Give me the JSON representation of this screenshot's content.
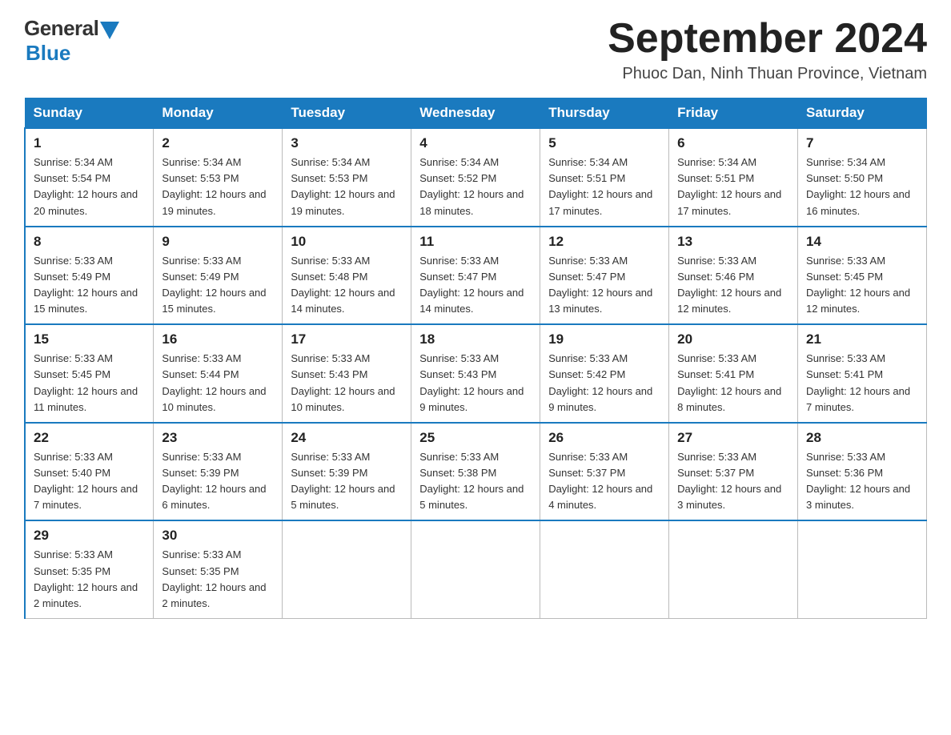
{
  "header": {
    "logo_general": "General",
    "logo_blue": "Blue",
    "month_title": "September 2024",
    "subtitle": "Phuoc Dan, Ninh Thuan Province, Vietnam"
  },
  "days_of_week": [
    "Sunday",
    "Monday",
    "Tuesday",
    "Wednesday",
    "Thursday",
    "Friday",
    "Saturday"
  ],
  "weeks": [
    [
      {
        "day": "1",
        "sunrise": "Sunrise: 5:34 AM",
        "sunset": "Sunset: 5:54 PM",
        "daylight": "Daylight: 12 hours and 20 minutes."
      },
      {
        "day": "2",
        "sunrise": "Sunrise: 5:34 AM",
        "sunset": "Sunset: 5:53 PM",
        "daylight": "Daylight: 12 hours and 19 minutes."
      },
      {
        "day": "3",
        "sunrise": "Sunrise: 5:34 AM",
        "sunset": "Sunset: 5:53 PM",
        "daylight": "Daylight: 12 hours and 19 minutes."
      },
      {
        "day": "4",
        "sunrise": "Sunrise: 5:34 AM",
        "sunset": "Sunset: 5:52 PM",
        "daylight": "Daylight: 12 hours and 18 minutes."
      },
      {
        "day": "5",
        "sunrise": "Sunrise: 5:34 AM",
        "sunset": "Sunset: 5:51 PM",
        "daylight": "Daylight: 12 hours and 17 minutes."
      },
      {
        "day": "6",
        "sunrise": "Sunrise: 5:34 AM",
        "sunset": "Sunset: 5:51 PM",
        "daylight": "Daylight: 12 hours and 17 minutes."
      },
      {
        "day": "7",
        "sunrise": "Sunrise: 5:34 AM",
        "sunset": "Sunset: 5:50 PM",
        "daylight": "Daylight: 12 hours and 16 minutes."
      }
    ],
    [
      {
        "day": "8",
        "sunrise": "Sunrise: 5:33 AM",
        "sunset": "Sunset: 5:49 PM",
        "daylight": "Daylight: 12 hours and 15 minutes."
      },
      {
        "day": "9",
        "sunrise": "Sunrise: 5:33 AM",
        "sunset": "Sunset: 5:49 PM",
        "daylight": "Daylight: 12 hours and 15 minutes."
      },
      {
        "day": "10",
        "sunrise": "Sunrise: 5:33 AM",
        "sunset": "Sunset: 5:48 PM",
        "daylight": "Daylight: 12 hours and 14 minutes."
      },
      {
        "day": "11",
        "sunrise": "Sunrise: 5:33 AM",
        "sunset": "Sunset: 5:47 PM",
        "daylight": "Daylight: 12 hours and 14 minutes."
      },
      {
        "day": "12",
        "sunrise": "Sunrise: 5:33 AM",
        "sunset": "Sunset: 5:47 PM",
        "daylight": "Daylight: 12 hours and 13 minutes."
      },
      {
        "day": "13",
        "sunrise": "Sunrise: 5:33 AM",
        "sunset": "Sunset: 5:46 PM",
        "daylight": "Daylight: 12 hours and 12 minutes."
      },
      {
        "day": "14",
        "sunrise": "Sunrise: 5:33 AM",
        "sunset": "Sunset: 5:45 PM",
        "daylight": "Daylight: 12 hours and 12 minutes."
      }
    ],
    [
      {
        "day": "15",
        "sunrise": "Sunrise: 5:33 AM",
        "sunset": "Sunset: 5:45 PM",
        "daylight": "Daylight: 12 hours and 11 minutes."
      },
      {
        "day": "16",
        "sunrise": "Sunrise: 5:33 AM",
        "sunset": "Sunset: 5:44 PM",
        "daylight": "Daylight: 12 hours and 10 minutes."
      },
      {
        "day": "17",
        "sunrise": "Sunrise: 5:33 AM",
        "sunset": "Sunset: 5:43 PM",
        "daylight": "Daylight: 12 hours and 10 minutes."
      },
      {
        "day": "18",
        "sunrise": "Sunrise: 5:33 AM",
        "sunset": "Sunset: 5:43 PM",
        "daylight": "Daylight: 12 hours and 9 minutes."
      },
      {
        "day": "19",
        "sunrise": "Sunrise: 5:33 AM",
        "sunset": "Sunset: 5:42 PM",
        "daylight": "Daylight: 12 hours and 9 minutes."
      },
      {
        "day": "20",
        "sunrise": "Sunrise: 5:33 AM",
        "sunset": "Sunset: 5:41 PM",
        "daylight": "Daylight: 12 hours and 8 minutes."
      },
      {
        "day": "21",
        "sunrise": "Sunrise: 5:33 AM",
        "sunset": "Sunset: 5:41 PM",
        "daylight": "Daylight: 12 hours and 7 minutes."
      }
    ],
    [
      {
        "day": "22",
        "sunrise": "Sunrise: 5:33 AM",
        "sunset": "Sunset: 5:40 PM",
        "daylight": "Daylight: 12 hours and 7 minutes."
      },
      {
        "day": "23",
        "sunrise": "Sunrise: 5:33 AM",
        "sunset": "Sunset: 5:39 PM",
        "daylight": "Daylight: 12 hours and 6 minutes."
      },
      {
        "day": "24",
        "sunrise": "Sunrise: 5:33 AM",
        "sunset": "Sunset: 5:39 PM",
        "daylight": "Daylight: 12 hours and 5 minutes."
      },
      {
        "day": "25",
        "sunrise": "Sunrise: 5:33 AM",
        "sunset": "Sunset: 5:38 PM",
        "daylight": "Daylight: 12 hours and 5 minutes."
      },
      {
        "day": "26",
        "sunrise": "Sunrise: 5:33 AM",
        "sunset": "Sunset: 5:37 PM",
        "daylight": "Daylight: 12 hours and 4 minutes."
      },
      {
        "day": "27",
        "sunrise": "Sunrise: 5:33 AM",
        "sunset": "Sunset: 5:37 PM",
        "daylight": "Daylight: 12 hours and 3 minutes."
      },
      {
        "day": "28",
        "sunrise": "Sunrise: 5:33 AM",
        "sunset": "Sunset: 5:36 PM",
        "daylight": "Daylight: 12 hours and 3 minutes."
      }
    ],
    [
      {
        "day": "29",
        "sunrise": "Sunrise: 5:33 AM",
        "sunset": "Sunset: 5:35 PM",
        "daylight": "Daylight: 12 hours and 2 minutes."
      },
      {
        "day": "30",
        "sunrise": "Sunrise: 5:33 AM",
        "sunset": "Sunset: 5:35 PM",
        "daylight": "Daylight: 12 hours and 2 minutes."
      },
      null,
      null,
      null,
      null,
      null
    ]
  ]
}
